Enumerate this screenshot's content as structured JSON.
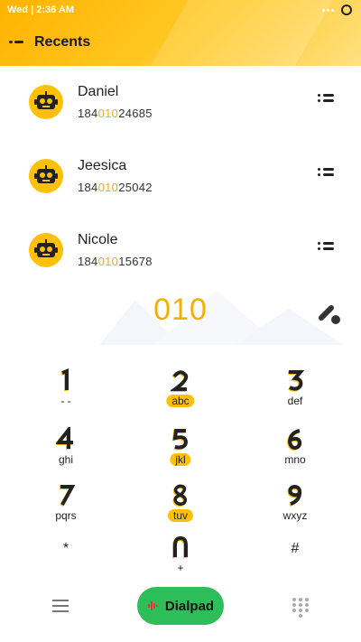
{
  "status_bar": {
    "time": "Wed | 2:36 AM"
  },
  "header": {
    "title": "Recents"
  },
  "contacts": [
    {
      "name": "Daniel",
      "number_prefix": "184",
      "number_match": "010",
      "number_suffix": "24685"
    },
    {
      "name": "Jeesica",
      "number_prefix": "184",
      "number_match": "010",
      "number_suffix": "25042"
    },
    {
      "name": "Nicole",
      "number_prefix": "184",
      "number_match": "010",
      "number_suffix": "15678"
    }
  ],
  "display": {
    "number": "010"
  },
  "dialpad": {
    "keys": [
      {
        "digit": "1",
        "letters": "- -",
        "highlighted": false
      },
      {
        "digit": "2",
        "letters": "abc",
        "highlighted": true
      },
      {
        "digit": "3",
        "letters": "def",
        "highlighted": false
      },
      {
        "digit": "4",
        "letters": "ghi",
        "highlighted": false
      },
      {
        "digit": "5",
        "letters": "jkl",
        "highlighted": true
      },
      {
        "digit": "6",
        "letters": "mno",
        "highlighted": false
      },
      {
        "digit": "7",
        "letters": "pqrs",
        "highlighted": false
      },
      {
        "digit": "8",
        "letters": "tuv",
        "highlighted": true
      },
      {
        "digit": "9",
        "letters": "wxyz",
        "highlighted": false
      },
      {
        "digit": "*",
        "letters": "",
        "highlighted": false
      },
      {
        "digit": "0",
        "letters": "+",
        "highlighted": false
      },
      {
        "digit": "#",
        "letters": "",
        "highlighted": false
      }
    ]
  },
  "bottom_bar": {
    "dialpad_label": "Dialpad"
  },
  "colors": {
    "accent": "#FFC107",
    "number": "#F5B000",
    "dialpad_button": "#2DBE5A",
    "header_start": "#FFB300",
    "header_end": "#FFE082"
  },
  "icons": [
    "back-icon",
    "robot-avatar-icon",
    "contact-menu-icon",
    "erase-icon",
    "menu-icon",
    "voice-icon",
    "grid-icon",
    "more-icon",
    "ring-icon"
  ]
}
